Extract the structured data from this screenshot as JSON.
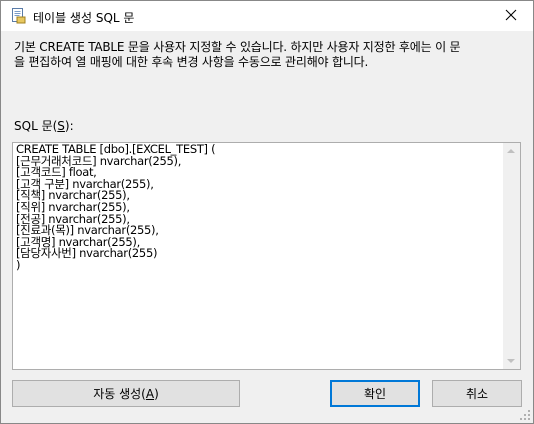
{
  "window": {
    "title": "테이블 생성 SQL 문",
    "title_icon": "sql-script-icon",
    "close_icon": "close-icon"
  },
  "description": {
    "line1": "기본 CREATE TABLE 문을 사용자 지정할 수 있습니다. 하지만 사용자 지정한 후에는 이 문",
    "line2": "을 편집하여 열 매핑에 대한 후속 변경 사항을 수동으로 관리해야 합니다."
  },
  "sql_label": {
    "before": "SQL 문(",
    "mnemonic": "S",
    "after": "):"
  },
  "sql_text": "CREATE TABLE [dbo].[EXCEL_TEST] (\n[근무거래처코드] nvarchar(255),\n[고객코드] float,\n[고객 구분] nvarchar(255),\n[직책] nvarchar(255),\n[직위] nvarchar(255),\n[전공] nvarchar(255),\n[진료과(목)] nvarchar(255),\n[고객명] nvarchar(255),\n[담당자사번] nvarchar(255)\n)",
  "buttons": {
    "auto_generate": {
      "before": "자동 생성(",
      "mnemonic": "A",
      "after": ")"
    },
    "ok": "확인",
    "cancel": "취소"
  },
  "colors": {
    "dialog_background": "#f0f0f0",
    "default_button_border": "#0078d7"
  }
}
